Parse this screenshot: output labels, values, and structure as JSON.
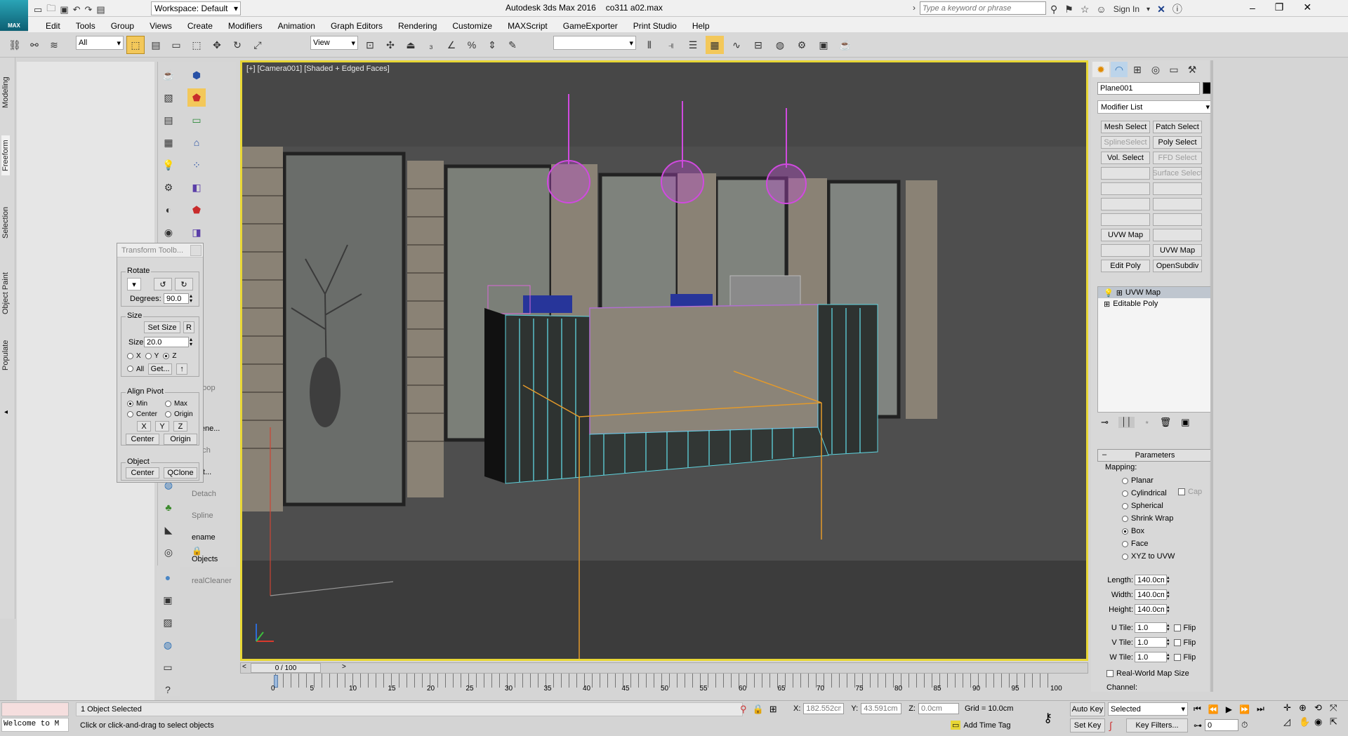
{
  "app": {
    "title": "Autodesk 3ds Max 2016",
    "filename": "co311 a02.max",
    "logo_text": "MAX",
    "workspace": "Workspace: Default"
  },
  "search": {
    "placeholder": "Type a keyword or phrase"
  },
  "signin": "Sign In",
  "menu": [
    "Edit",
    "Tools",
    "Group",
    "Views",
    "Create",
    "Modifiers",
    "Animation",
    "Graph Editors",
    "Rendering",
    "Customize",
    "MAXScript",
    "GameExporter",
    "Print Studio",
    "Help"
  ],
  "toolbar": {
    "filter": "All",
    "refcoord": "View"
  },
  "ribbon_tabs": [
    "Modeling",
    "Freeform",
    "Selection",
    "Object Paint",
    "Populate"
  ],
  "viewport": {
    "label": "[+] [Camera001] [Shaded + Edged Faces]"
  },
  "left_tools": {
    "snippets": [
      "ft Loop",
      "Scene...",
      "etach",
      "port...",
      "Detach Spline",
      "ename Objects",
      "realCleaner"
    ]
  },
  "transform_toolbox": {
    "title": "Transform Toolb...",
    "rotate_title": "Rotate",
    "degrees_label": "Degrees:",
    "degrees_value": "90.0",
    "size_title": "Size",
    "set_size": "Set Size",
    "r_btn": "R",
    "size_label": "Size",
    "size_value": "20.0",
    "axis_x": "X",
    "axis_y": "Y",
    "axis_z": "Z",
    "all": "All",
    "get": "Get...",
    "align_title": "Align Pivot",
    "min": "Min",
    "max": "Max",
    "center": "Center",
    "origin": "Origin",
    "bx": "X",
    "by": "Y",
    "bz": "Z",
    "center_btn": "Center",
    "origin_btn": "Origin",
    "object_title": "Object",
    "obj_center": "Center",
    "qclone": "QClone"
  },
  "command_panel": {
    "object_name": "Plane001",
    "object_color": "#000000",
    "modifier_list": "Modifier List",
    "modifier_buttons": [
      {
        "label": "Mesh Select",
        "enabled": true
      },
      {
        "label": "Patch Select",
        "enabled": true
      },
      {
        "label": "SplineSelect",
        "enabled": false
      },
      {
        "label": "Poly Select",
        "enabled": true
      },
      {
        "label": "Vol. Select",
        "enabled": true
      },
      {
        "label": "FFD Select",
        "enabled": false
      },
      {
        "label": "",
        "enabled": false
      },
      {
        "label": "Surface Select",
        "enabled": false
      },
      {
        "label": "",
        "enabled": true
      },
      {
        "label": "",
        "enabled": true
      },
      {
        "label": "",
        "enabled": true
      },
      {
        "label": "",
        "enabled": true
      },
      {
        "label": "",
        "enabled": true
      },
      {
        "label": "",
        "enabled": true
      },
      {
        "label": "UVW Map",
        "enabled": true
      },
      {
        "label": "",
        "enabled": true
      },
      {
        "label": "",
        "enabled": true
      },
      {
        "label": "UVW Map",
        "enabled": true
      },
      {
        "label": "Edit Poly",
        "enabled": true
      },
      {
        "label": "OpenSubdiv",
        "enabled": true
      }
    ],
    "stack": [
      "UVW Map",
      "Editable Poly"
    ],
    "parameters_title": "Parameters",
    "mapping_label": "Mapping:",
    "mapping_options": [
      "Planar",
      "Cylindrical",
      "Spherical",
      "Shrink Wrap",
      "Box",
      "Face",
      "XYZ to UVW"
    ],
    "mapping_selected": "Box",
    "cap_label": "Cap",
    "length_label": "Length:",
    "length": "140.0cm",
    "width_label": "Width:",
    "width": "140.0cm",
    "height_label": "Height:",
    "height": "140.0cm",
    "utile_label": "U Tile:",
    "utile": "1.0",
    "vtile_label": "V Tile:",
    "vtile": "1.0",
    "wtile_label": "W Tile:",
    "wtile": "1.0",
    "flip": "Flip",
    "realworld": "Real-World Map Size",
    "channel_label": "Channel:"
  },
  "timeline": {
    "frame": "0 / 100",
    "ticks": [
      "0",
      "5",
      "10",
      "15",
      "20",
      "25",
      "30",
      "35",
      "40",
      "45",
      "50",
      "55",
      "60",
      "65",
      "70",
      "75",
      "80",
      "85",
      "90",
      "95",
      "100"
    ]
  },
  "status": {
    "maxscript": "Welcome to M",
    "selected": "1 Object Selected",
    "prompt": "Click or click-and-drag to select objects",
    "x_label": "X:",
    "x": "182.552cm",
    "y_label": "Y:",
    "y": "43.591cm",
    "z_label": "Z:",
    "z": "0.0cm",
    "grid": "Grid = 10.0cm",
    "add_time_tag": "Add Time Tag",
    "auto_key": "Auto Key",
    "set_key": "Set Key",
    "selected_dropdown": "Selected",
    "key_filters": "Key Filters...",
    "frame_field": "0"
  }
}
